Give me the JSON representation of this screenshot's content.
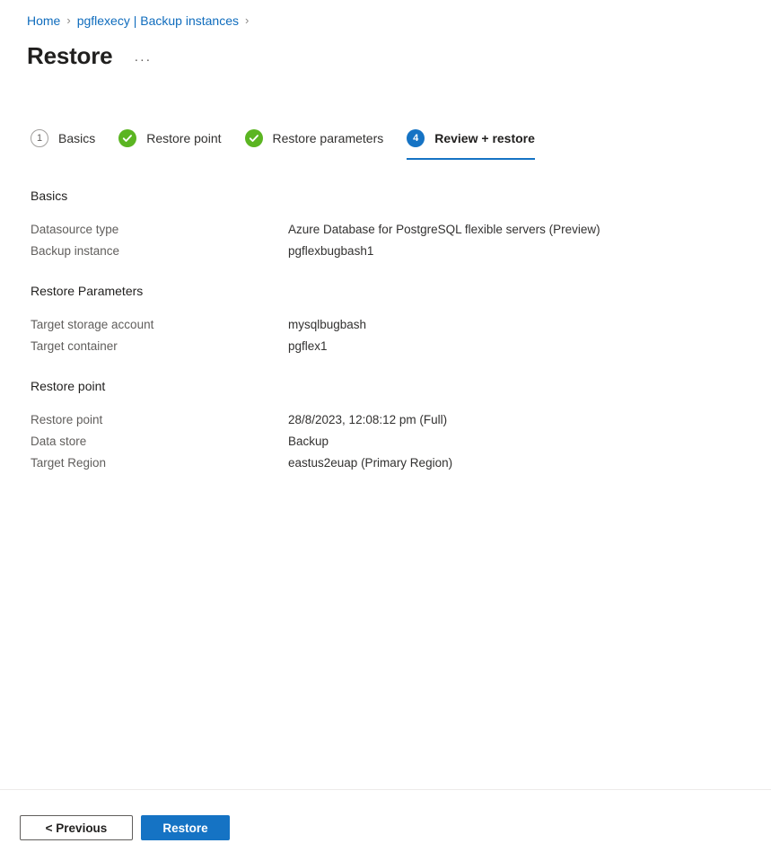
{
  "breadcrumb": {
    "separator": "›",
    "items": [
      {
        "label": "Home"
      },
      {
        "label": "pgflexecy | Backup instances"
      }
    ]
  },
  "header": {
    "title": "Restore",
    "more_actions": "···"
  },
  "wizard": {
    "steps": [
      {
        "badge": "1",
        "label": "Basics",
        "state": "pending"
      },
      {
        "badge": "check",
        "label": "Restore point",
        "state": "done"
      },
      {
        "badge": "check",
        "label": "Restore parameters",
        "state": "done"
      },
      {
        "badge": "4",
        "label": "Review + restore",
        "state": "current"
      }
    ]
  },
  "sections": [
    {
      "heading": "Basics",
      "rows": [
        {
          "label": "Datasource type",
          "value": "Azure Database for PostgreSQL flexible servers (Preview)"
        },
        {
          "label": "Backup instance",
          "value": "pgflexbugbash1"
        }
      ]
    },
    {
      "heading": "Restore Parameters",
      "rows": [
        {
          "label": "Target storage account",
          "value": "mysqlbugbash"
        },
        {
          "label": "Target container",
          "value": "pgflex1"
        }
      ]
    },
    {
      "heading": "Restore point",
      "rows": [
        {
          "label": "Restore point",
          "value": "28/8/2023, 12:08:12 pm (Full)"
        },
        {
          "label": "Data store",
          "value": "Backup"
        },
        {
          "label": "Target Region",
          "value": "eastus2euap (Primary Region)"
        }
      ]
    }
  ],
  "footer": {
    "previous_label": "< Previous",
    "restore_label": "Restore"
  },
  "colors": {
    "accent_blue": "#1573c4",
    "link_blue": "#0f6cbd",
    "success_green": "#5bb522",
    "label_gray": "#605e5c",
    "text_dark": "#201f1e"
  }
}
